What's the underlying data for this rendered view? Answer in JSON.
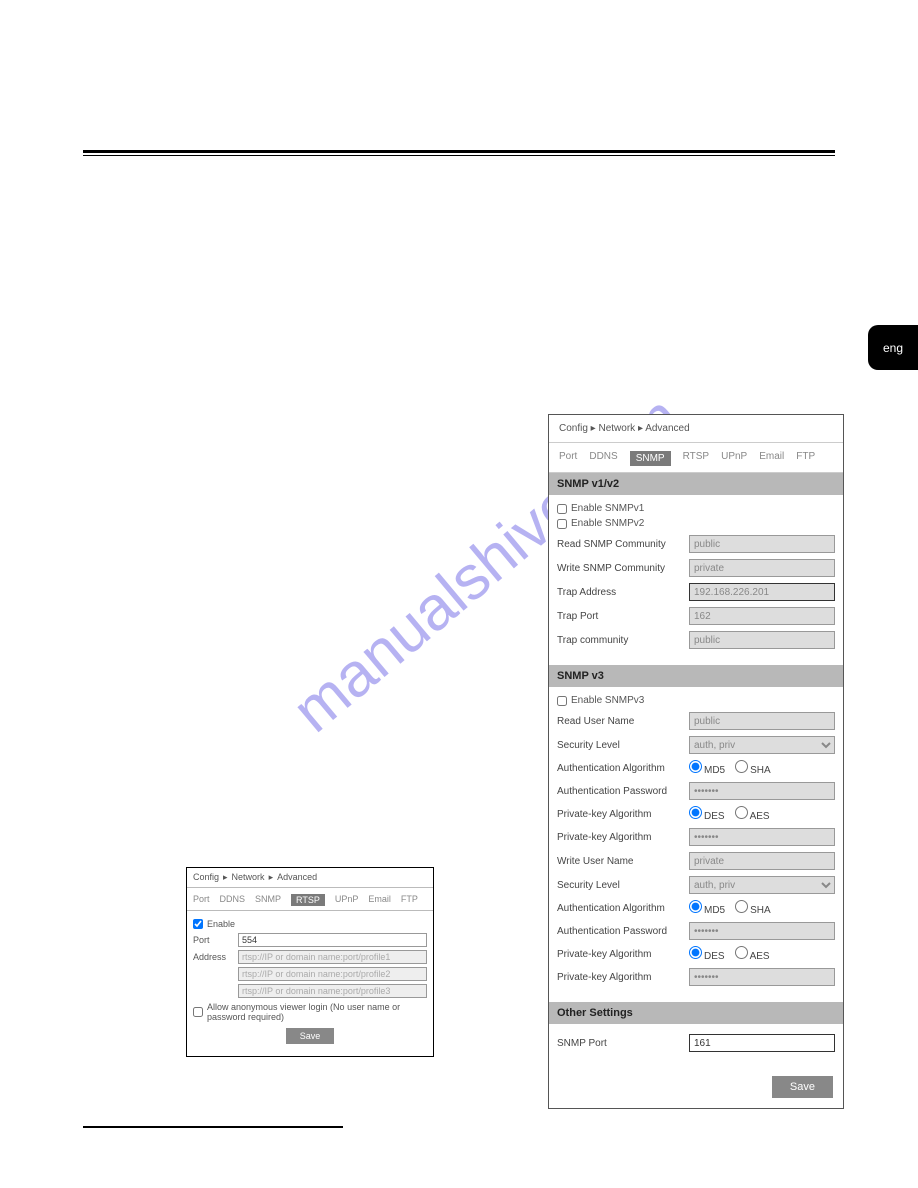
{
  "lang_tab": "eng",
  "watermark": "manualshive.com",
  "rtsp": {
    "breadcrumb": [
      "Config",
      "Network",
      "Advanced"
    ],
    "tabs": [
      "Port",
      "DDNS",
      "SNMP",
      "RTSP",
      "UPnP",
      "Email",
      "FTP"
    ],
    "active_tab": "RTSP",
    "enable_label": "Enable",
    "enable_checked": true,
    "port_label": "Port",
    "port_value": "554",
    "address_label": "Address",
    "address1": "rtsp://IP or domain name:port/profile1",
    "address2": "rtsp://IP or domain name:port/profile2",
    "address3": "rtsp://IP or domain name:port/profile3",
    "anon_label": "Allow anonymous viewer login (No user name or password required)",
    "save_label": "Save"
  },
  "snmp": {
    "breadcrumb": [
      "Config",
      "Network",
      "Advanced"
    ],
    "tabs": [
      "Port",
      "DDNS",
      "SNMP",
      "RTSP",
      "UPnP",
      "Email",
      "FTP"
    ],
    "active_tab": "SNMP",
    "sect1_title": "SNMP v1/v2",
    "enable_v1": "Enable SNMPv1",
    "enable_v2": "Enable SNMPv2",
    "read_comm_label": "Read SNMP Community",
    "read_comm_value": "public",
    "write_comm_label": "Write SNMP Community",
    "write_comm_value": "private",
    "trap_addr_label": "Trap Address",
    "trap_addr_value": "192.168.226.201",
    "trap_port_label": "Trap Port",
    "trap_port_value": "162",
    "trap_comm_label": "Trap community",
    "trap_comm_value": "public",
    "sect2_title": "SNMP v3",
    "enable_v3": "Enable SNMPv3",
    "read_user_label": "Read User Name",
    "read_user_value": "public",
    "seclvl_label": "Security Level",
    "seclvl_value": "auth, priv",
    "authalg_label": "Authentication Algorithm",
    "md5": "MD5",
    "sha": "SHA",
    "authpw_label": "Authentication Password",
    "authpw_value": "•••••••",
    "pkalg_label": "Private-key Algorithm",
    "des": "DES",
    "aes": "AES",
    "pkpw_label": "Private-key Algorithm",
    "pkpw_value": "•••••••",
    "write_user_label": "Write User Name",
    "write_user_value": "private",
    "sect3_title": "Other Settings",
    "snmp_port_label": "SNMP Port",
    "snmp_port_value": "161",
    "save_label": "Save"
  }
}
